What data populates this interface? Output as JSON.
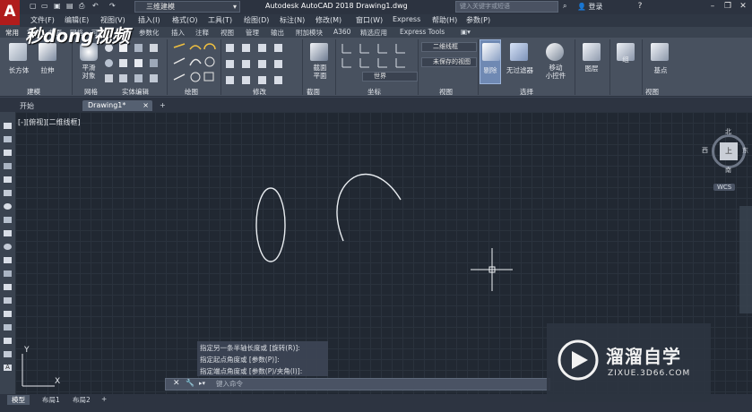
{
  "app": {
    "logo": "A",
    "window_title": "Autodesk AutoCAD 2018    Drawing1.dwg",
    "login": "登录"
  },
  "quick_access": {
    "workspace": "三维建模",
    "search_placeholder": "键入关键字或短语"
  },
  "menu": [
    "文件(F)",
    "编辑(E)",
    "视图(V)",
    "插入(I)",
    "格式(O)",
    "工具(T)",
    "绘图(D)",
    "标注(N)",
    "修改(M)",
    "参数(P)",
    "窗口(W)",
    "帮助(H)",
    "Express"
  ],
  "ribbon_tabs": [
    "常用",
    "实体",
    "曲面",
    "网格",
    "可视化",
    "参数化",
    "插入",
    "注释",
    "视图",
    "管理",
    "输出",
    "附加模块",
    "A360",
    "精选应用",
    "Express Tools"
  ],
  "ribbon": {
    "modeling": {
      "box": "长方体",
      "extrude": "拉伸",
      "label": "建模"
    },
    "mesh": {
      "smooth": "平滑\n对象",
      "label": "网格"
    },
    "solid_edit": {
      "label": "实体编辑"
    },
    "draw": {
      "label": "绘图"
    },
    "modify": {
      "label": "修改"
    },
    "section": {
      "plane": "截面\n平面",
      "label": "截面"
    },
    "coordinates": {
      "world": "世界",
      "label": "坐标"
    },
    "view": {
      "visual_style": "二维线框",
      "saved_view": "未保存的视图",
      "label": "视图"
    },
    "selection": {
      "cull": "剔除",
      "filter": "无过滤器",
      "gizmo": "移动\n小控件",
      "label": "选择"
    },
    "layers": {
      "label": "图层"
    },
    "groups": {
      "label": "组"
    },
    "view2": {
      "base": "基点",
      "label": "视图"
    }
  },
  "doc_tabs": {
    "start": "开始",
    "drawing": "Drawing1*"
  },
  "viewport": {
    "label": "[-][俯视][二维线框]",
    "viewcube": {
      "north": "北",
      "south": "南",
      "east": "东",
      "west": "西",
      "top": "上"
    },
    "wcs": "WCS",
    "axis_y": "Y",
    "axis_x": "X"
  },
  "command": {
    "history": [
      "指定另一条半轴长度或 [旋转(R)]:",
      "指定起点角度或 [参数(P)]:",
      "指定端点角度或 [参数(P)/夹角(I)]:"
    ],
    "placeholder": "键入命令"
  },
  "layout_tabs": [
    "模型",
    "布局1",
    "布局2"
  ],
  "watermark": {
    "brand": "溜溜自学",
    "url": "ZIXUE.3D66.COM",
    "top": "秒dong视频"
  }
}
